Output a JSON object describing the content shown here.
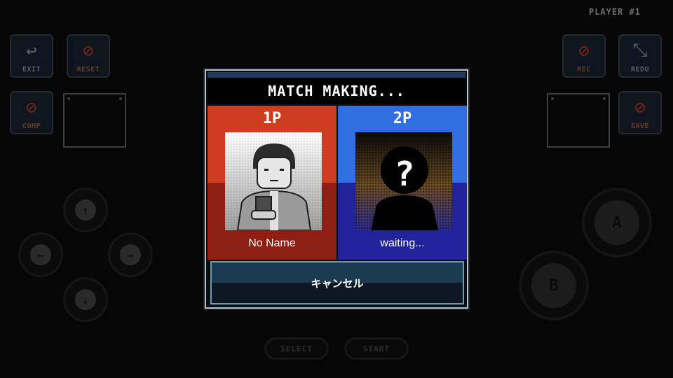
{
  "player_label": "PLAYER #1",
  "left_buttons": [
    {
      "label": "EXIT",
      "icon": "back-arrow-icon",
      "glyph": "↩",
      "disabled": false
    },
    {
      "label": "RESET",
      "icon": "reset-icon",
      "glyph": "⊘",
      "disabled": true
    },
    {
      "label": "COMP",
      "icon": "comp-icon",
      "glyph": "⊘",
      "disabled": true
    }
  ],
  "right_buttons": [
    {
      "label": "REC",
      "icon": "record-icon",
      "glyph": "⊘",
      "disabled": true
    },
    {
      "label": "REDU",
      "icon": "shrink-icon",
      "glyph": "⤡",
      "disabled": false
    },
    {
      "label": "SAVE",
      "icon": "save-icon",
      "glyph": "⊘",
      "disabled": true
    }
  ],
  "dpad": {
    "up": "↑",
    "left": "←",
    "right": "→",
    "down": "↓"
  },
  "action_buttons": {
    "a": "A",
    "b": "B"
  },
  "select_label": "SELECT",
  "start_label": "START",
  "dialog": {
    "title": "MATCH MAKING...",
    "player1": {
      "tag": "1P",
      "name": "No Name"
    },
    "player2": {
      "tag": "2P",
      "name": "waiting..."
    },
    "cancel_label": "キャンセル"
  },
  "colors": {
    "p1_panel": "#cf3d20",
    "p2_panel": "#2f6de0",
    "title_bg": "#000000",
    "dialog_border": "#b9c2cc"
  }
}
